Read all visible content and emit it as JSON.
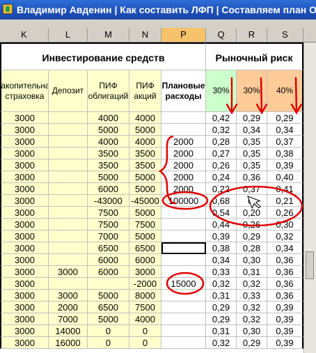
{
  "window": {
    "title": "Владимир Авденин | Как составить ЛФП | Составляем план Олега"
  },
  "columns": [
    "K",
    "L",
    "M",
    "N",
    "P",
    "Q",
    "R",
    "S"
  ],
  "selected_column": "P",
  "sections": {
    "investment_title": "Инвестирование средств",
    "market_risk_title": "Рыночный риск"
  },
  "headers": {
    "K": "Накопительная страховка",
    "L": "Депозит",
    "M": "ПИФ облигаций",
    "N": "ПИФ акций",
    "P": "Плановые расходы",
    "Q": "30%",
    "R": "30%",
    "S": "40%"
  },
  "rows": [
    {
      "K": "3000",
      "L": "",
      "M": "4000",
      "N": "4000",
      "P": "",
      "Q": "0,42",
      "R": "0,29",
      "S": "0,29"
    },
    {
      "K": "3000",
      "L": "",
      "M": "5000",
      "N": "5000",
      "P": "",
      "Q": "0,32",
      "R": "0,34",
      "S": "0,34"
    },
    {
      "K": "3000",
      "L": "",
      "M": "4000",
      "N": "4000",
      "P": "2000",
      "Q": "0,28",
      "R": "0,35",
      "S": "0,37"
    },
    {
      "K": "3000",
      "L": "",
      "M": "3500",
      "N": "3500",
      "P": "2000",
      "Q": "0,27",
      "R": "0,35",
      "S": "0,38"
    },
    {
      "K": "3000",
      "L": "",
      "M": "3500",
      "N": "3500",
      "P": "2000",
      "Q": "0,26",
      "R": "0,35",
      "S": "0,39"
    },
    {
      "K": "3000",
      "L": "",
      "M": "5000",
      "N": "5000",
      "P": "2000",
      "Q": "0,24",
      "R": "0,36",
      "S": "0,40"
    },
    {
      "K": "3000",
      "L": "",
      "M": "6000",
      "N": "5000",
      "P": "2000",
      "Q": "0,22",
      "R": "0,37",
      "S": "0,41"
    },
    {
      "K": "3000",
      "L": "",
      "M": "-43000",
      "N": "-45000",
      "P": "100000",
      "Q": "0,68",
      "R": "0,",
      "S": "0,21"
    },
    {
      "K": "3000",
      "L": "",
      "M": "7500",
      "N": "5000",
      "P": "",
      "Q": "0,54",
      "R": "0,20",
      "S": "0,26"
    },
    {
      "K": "3000",
      "L": "",
      "M": "7500",
      "N": "7500",
      "P": "",
      "Q": "0,44",
      "R": "0,26",
      "S": "0,30"
    },
    {
      "K": "3000",
      "L": "",
      "M": "7000",
      "N": "5000",
      "P": "",
      "Q": "0,39",
      "R": "0,29",
      "S": "0,32"
    },
    {
      "K": "3000",
      "L": "",
      "M": "6500",
      "N": "6500",
      "P": "",
      "Q": "0,38",
      "R": "0,28",
      "S": "0,34"
    },
    {
      "K": "3000",
      "L": "",
      "M": "6000",
      "N": "6000",
      "P": "",
      "Q": "0,34",
      "R": "0,30",
      "S": "0,36"
    },
    {
      "K": "3000",
      "L": "3000",
      "M": "6000",
      "N": "3000",
      "P": "",
      "Q": "0,33",
      "R": "0,31",
      "S": "0,36"
    },
    {
      "K": "3000",
      "L": "",
      "M": "",
      "N": "-2000",
      "P": "15000",
      "Q": "0,32",
      "R": "0,32",
      "S": "0,36"
    },
    {
      "K": "3000",
      "L": "3000",
      "M": "5000",
      "N": "8000",
      "P": "",
      "Q": "0,31",
      "R": "0,33",
      "S": "0,36"
    },
    {
      "K": "3000",
      "L": "2000",
      "M": "6500",
      "N": "7500",
      "P": "",
      "Q": "0,29",
      "R": "0,32",
      "S": "0,39"
    },
    {
      "K": "3000",
      "L": "7000",
      "M": "5000",
      "N": "4000",
      "P": "",
      "Q": "0,29",
      "R": "0,32",
      "S": "0,39"
    },
    {
      "K": "3000",
      "L": "14000",
      "M": "0",
      "N": "0",
      "P": "",
      "Q": "0,31",
      "R": "0,30",
      "S": "0,39"
    },
    {
      "K": "3000",
      "L": "16000",
      "M": "0",
      "N": "0",
      "P": "",
      "Q": "0,32",
      "R": "0,29",
      "S": "0,39"
    }
  ],
  "colors": {
    "title_bar": "#1d4fb8",
    "header_fill": "#ffffcc",
    "risk_q_fill": "#ccffcc",
    "risk_rs_fill": "#ffcc99",
    "annotation": "#e00000"
  },
  "icons": {
    "app": "spreadsheet-app-icon",
    "cursor": "mouse-pointer-icon"
  }
}
